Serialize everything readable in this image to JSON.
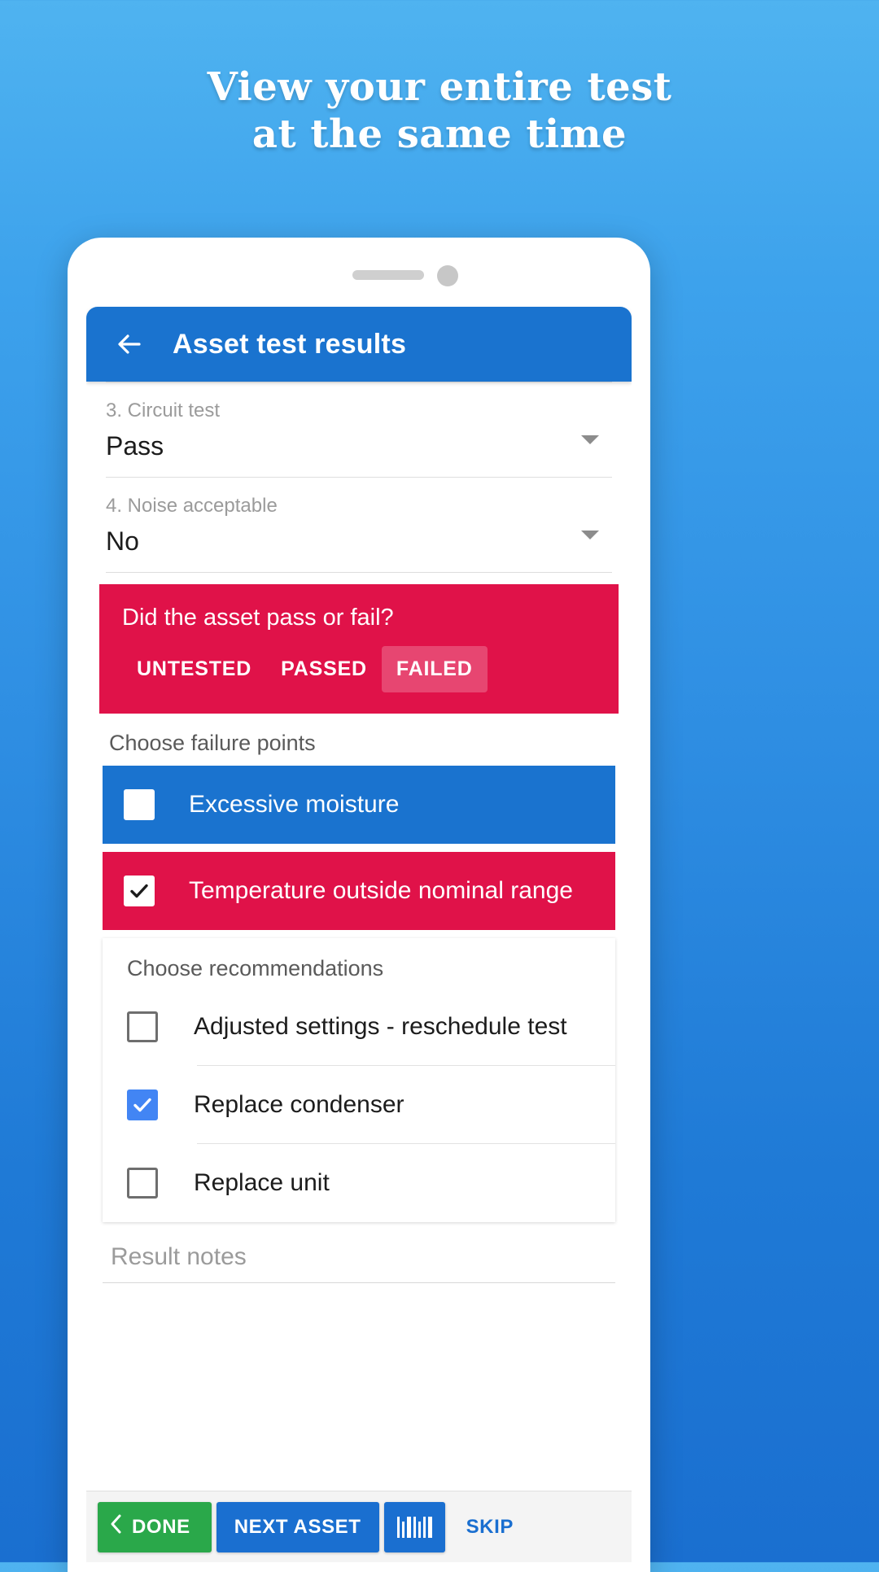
{
  "promo": {
    "line1": "View your entire test",
    "line2": "at the same time"
  },
  "colors": {
    "brand_blue": "#1a73cf",
    "crimson": "#e01249",
    "green": "#2aa84a",
    "checkbox_blue": "#4285f4",
    "background_top": "#4fb3f0",
    "background_bottom": "#1a6fd0"
  },
  "appbar": {
    "back_icon": "arrow-left-icon",
    "title": "Asset test results"
  },
  "fields": [
    {
      "label": "3. Circuit test",
      "value": "Pass",
      "icon": "chevron-down-icon"
    },
    {
      "label": "4. Noise acceptable",
      "value": "No",
      "icon": "chevron-down-icon"
    }
  ],
  "pass_fail": {
    "question": "Did the asset pass or fail?",
    "options": [
      {
        "label": "UNTESTED",
        "selected": false
      },
      {
        "label": "PASSED",
        "selected": false
      },
      {
        "label": "FAILED",
        "selected": true
      }
    ]
  },
  "failure_points": {
    "title": "Choose failure points",
    "items": [
      {
        "label": "Excessive moisture",
        "checked": false,
        "style": "blue"
      },
      {
        "label": "Temperature outside nominal range",
        "checked": true,
        "style": "crimson"
      }
    ]
  },
  "recommendations": {
    "title": "Choose recommendations",
    "items": [
      {
        "label": "Adjusted settings - reschedule test",
        "checked": false
      },
      {
        "label": "Replace condenser",
        "checked": true
      },
      {
        "label": "Replace unit",
        "checked": false
      }
    ]
  },
  "notes": {
    "placeholder": "Result notes",
    "value": ""
  },
  "actionbar": {
    "done_label": "DONE",
    "done_icon": "chevron-left-icon",
    "next_label": "NEXT ASSET",
    "scan_icon": "barcode-icon",
    "skip_label": "SKIP"
  }
}
